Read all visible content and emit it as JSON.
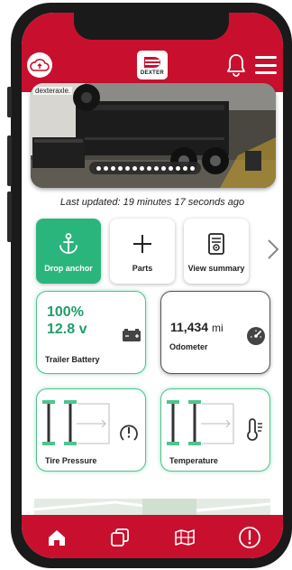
{
  "header": {
    "logo_text": "DEXTER",
    "icons": [
      "cloud-sync-icon",
      "bell-icon",
      "hamburger-menu-icon"
    ],
    "color": "#c8102e"
  },
  "photo": {
    "caption": "dexteraxle.",
    "carousel_dots": 14
  },
  "status": {
    "last_updated": "Last updated: 19 minutes 17 seconds ago"
  },
  "quick_actions": [
    {
      "label": "Drop anchor",
      "icon": "anchor-icon",
      "active": true
    },
    {
      "label": "Parts",
      "icon": "plus-icon",
      "active": false
    },
    {
      "label": "View summary",
      "icon": "summary-document-icon",
      "active": false
    }
  ],
  "cards": {
    "battery": {
      "percent": "100%",
      "voltage": "12.8 v",
      "label": "Trailer Battery",
      "icon": "battery-icon"
    },
    "odometer": {
      "value": "11,434",
      "unit": "mi",
      "label": "Odometer",
      "icon": "gauge-icon"
    },
    "tire_pressure": {
      "label": "Tire Pressure",
      "icon": "tire-pressure-warning-icon"
    },
    "temperature": {
      "label": "Temperature",
      "icon": "thermometer-icon"
    }
  },
  "tabbar": {
    "tabs": [
      "home-icon",
      "copy-icon",
      "map-icon",
      "alert-icon"
    ]
  },
  "colors": {
    "brand_red": "#c8102e",
    "accent_green": "#2ab57d",
    "axle_green": "#4ec48f"
  }
}
